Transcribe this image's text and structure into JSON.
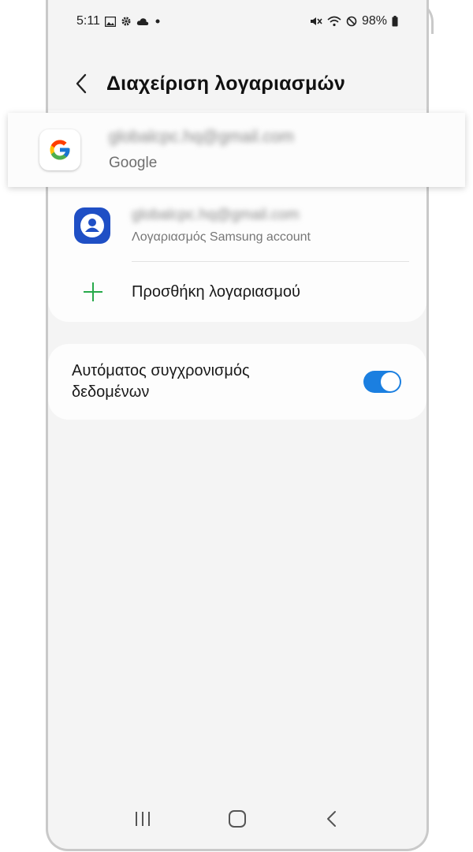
{
  "status_bar": {
    "time": "5:11",
    "battery": "98%",
    "left_icons": [
      "image-icon",
      "settings-gear-icon",
      "cloud-icon",
      "dot-icon"
    ],
    "right_icons": [
      "mute-vibrate-icon",
      "wifi-icon",
      "do-not-disturb-icon",
      "battery-icon"
    ]
  },
  "header": {
    "title": "Διαχείριση λογαριασμών",
    "back_icon": "chevron-left-icon"
  },
  "accounts": [
    {
      "email": "globalcpc.hq@gmail.com",
      "type": "Google",
      "icon": "google-icon",
      "highlighted": true
    },
    {
      "email": "globalcpc.hq@gmail.com",
      "type": "Λογαριασμός Samsung account",
      "icon": "samsung-account-icon",
      "highlighted": false
    }
  ],
  "add_account": {
    "label": "Προσθήκη λογαριασμού",
    "icon": "plus-icon"
  },
  "sync": {
    "label": "Αυτόματος συγχρονισμός δεδομένων",
    "enabled": true
  },
  "colors": {
    "accent_blue": "#1b7fe0",
    "plus_green": "#27a94a",
    "samsung_blue": "#1f4fc5"
  },
  "navbar": {
    "icons": [
      "recent-apps-icon",
      "home-icon",
      "back-icon"
    ]
  }
}
